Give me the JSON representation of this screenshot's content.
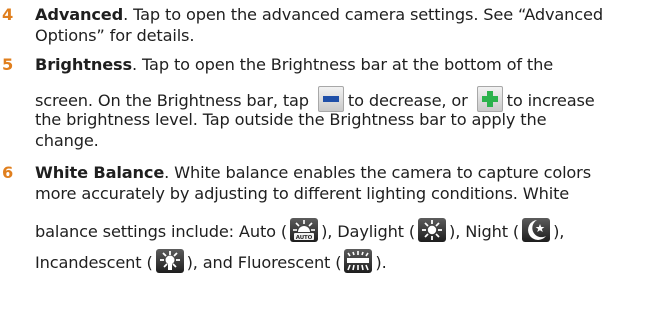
{
  "items": [
    {
      "number": "4",
      "term": "Advanced",
      "lines": [
        ". Tap to open the advanced camera settings. See “Advanced",
        "Options” for details."
      ]
    },
    {
      "number": "5",
      "term": "Brightness",
      "line1_rest": ". Tap to open the Brightness bar at the bottom of the",
      "line2_a": "screen. On the Brightness bar, tap",
      "line2_b": "to decrease, or",
      "line2_c": "to increase",
      "line3": "the brightness level. Tap outside the Brightness bar to apply the",
      "line4": "change.",
      "icons": {
        "decrease": "minus-icon",
        "increase": "plus-icon"
      }
    },
    {
      "number": "6",
      "term": "White Balance",
      "line1_rest": ". White balance enables the camera to capture colors",
      "line2": "more accurately by adjusting to different lighting conditions. White",
      "line3_a": "balance settings include: Auto (",
      "line3_b": "), Daylight (",
      "line3_c": "), Night (",
      "line3_d": "),",
      "line4_a": "Incandescent (",
      "line4_b": "), and Fluorescent (",
      "line4_c": ").",
      "auto_icon_text": "AUTO",
      "icons": {
        "auto": "wb-auto-icon",
        "daylight": "wb-daylight-icon",
        "night": "wb-night-icon",
        "incandescent": "wb-incandescent-icon",
        "fluorescent": "wb-fluorescent-icon"
      }
    }
  ],
  "colors": {
    "number": "#e07f1e",
    "text": "#1f1f1f",
    "icon_bg": "#2a2a2a",
    "button_sign": "#1f4fa8",
    "plus_sign": "#2bb24c"
  }
}
